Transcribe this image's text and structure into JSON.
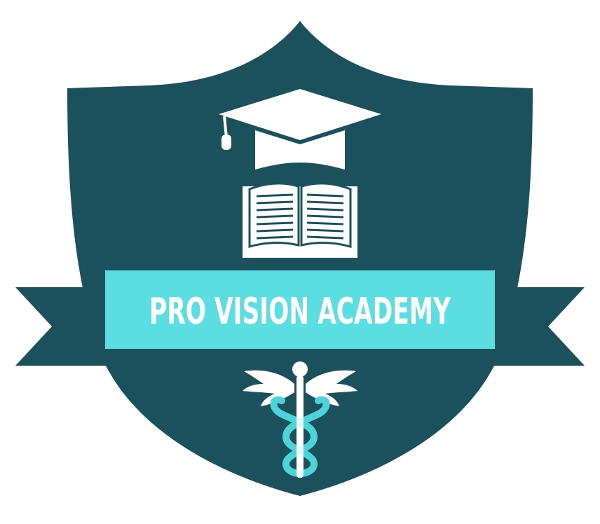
{
  "logo": {
    "name_text": "PRO VISION ACADEMY",
    "icons": {
      "top": "graduation-cap-icon",
      "middle": "open-book-icon",
      "bottom": "caduceus-icon"
    }
  },
  "colors": {
    "background": "#ffffff",
    "shield": "#1b515c",
    "banner": "#5cdde2",
    "banner_text": "#ffffff",
    "emblem": "#ffffff",
    "book_lines": "#1b515c",
    "snakes": "#4fd3da"
  }
}
